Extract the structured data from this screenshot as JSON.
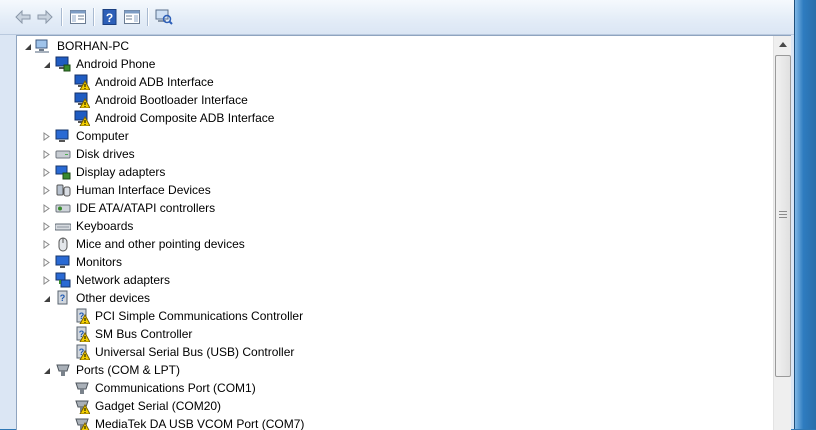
{
  "toolbar": {
    "buttons": [
      {
        "name": "back-button",
        "icon": "back-arrow-icon"
      },
      {
        "name": "forward-button",
        "icon": "forward-arrow-icon"
      },
      {
        "name": "show-hide-console-tree-button",
        "icon": "console-tree-icon"
      },
      {
        "name": "help-button",
        "icon": "help-icon",
        "glyph": "?"
      },
      {
        "name": "properties-pane-button",
        "icon": "properties-icon"
      },
      {
        "name": "scan-hardware-button",
        "icon": "scan-hardware-icon"
      }
    ]
  },
  "tree": [
    {
      "label": "BORHAN-PC",
      "icon": "computer-root-icon",
      "level": 0,
      "expander": "expanded"
    },
    {
      "label": "Android Phone",
      "icon": "android-phone-icon",
      "level": 1,
      "expander": "expanded"
    },
    {
      "label": "Android ADB Interface",
      "icon": "warning-device-icon",
      "level": 2,
      "expander": "none"
    },
    {
      "label": "Android Bootloader Interface",
      "icon": "warning-device-icon",
      "level": 2,
      "expander": "none"
    },
    {
      "label": "Android Composite ADB Interface",
      "icon": "warning-device-icon",
      "level": 2,
      "expander": "none"
    },
    {
      "label": "Computer",
      "icon": "computer-icon",
      "level": 1,
      "expander": "collapsed"
    },
    {
      "label": "Disk drives",
      "icon": "disk-drive-icon",
      "level": 1,
      "expander": "collapsed"
    },
    {
      "label": "Display adapters",
      "icon": "display-adapter-icon",
      "level": 1,
      "expander": "collapsed"
    },
    {
      "label": "Human Interface Devices",
      "icon": "hid-icon",
      "level": 1,
      "expander": "collapsed"
    },
    {
      "label": "IDE ATA/ATAPI controllers",
      "icon": "ide-controller-icon",
      "level": 1,
      "expander": "collapsed"
    },
    {
      "label": "Keyboards",
      "icon": "keyboard-icon",
      "level": 1,
      "expander": "collapsed"
    },
    {
      "label": "Mice and other pointing devices",
      "icon": "mouse-icon",
      "level": 1,
      "expander": "collapsed"
    },
    {
      "label": "Monitors",
      "icon": "monitor-icon",
      "level": 1,
      "expander": "collapsed"
    },
    {
      "label": "Network adapters",
      "icon": "network-adapter-icon",
      "level": 1,
      "expander": "collapsed"
    },
    {
      "label": "Other devices",
      "icon": "other-devices-icon",
      "level": 1,
      "expander": "expanded"
    },
    {
      "label": "PCI Simple Communications Controller",
      "icon": "unknown-device-warning-icon",
      "level": 2,
      "expander": "none"
    },
    {
      "label": "SM Bus Controller",
      "icon": "unknown-device-warning-icon",
      "level": 2,
      "expander": "none"
    },
    {
      "label": "Universal Serial Bus (USB) Controller",
      "icon": "unknown-device-warning-icon",
      "level": 2,
      "expander": "none"
    },
    {
      "label": "Ports (COM & LPT)",
      "icon": "port-icon",
      "level": 1,
      "expander": "expanded"
    },
    {
      "label": "Communications Port (COM1)",
      "icon": "port-icon",
      "level": 2,
      "expander": "none"
    },
    {
      "label": "Gadget Serial (COM20)",
      "icon": "port-warning-icon",
      "level": 2,
      "expander": "none"
    },
    {
      "label": "MediaTek DA USB VCOM Port (COM7)",
      "icon": "port-warning-icon",
      "level": 2,
      "expander": "none"
    }
  ],
  "scrollbar": {
    "up_icon": "scroll-up-arrow-icon"
  }
}
